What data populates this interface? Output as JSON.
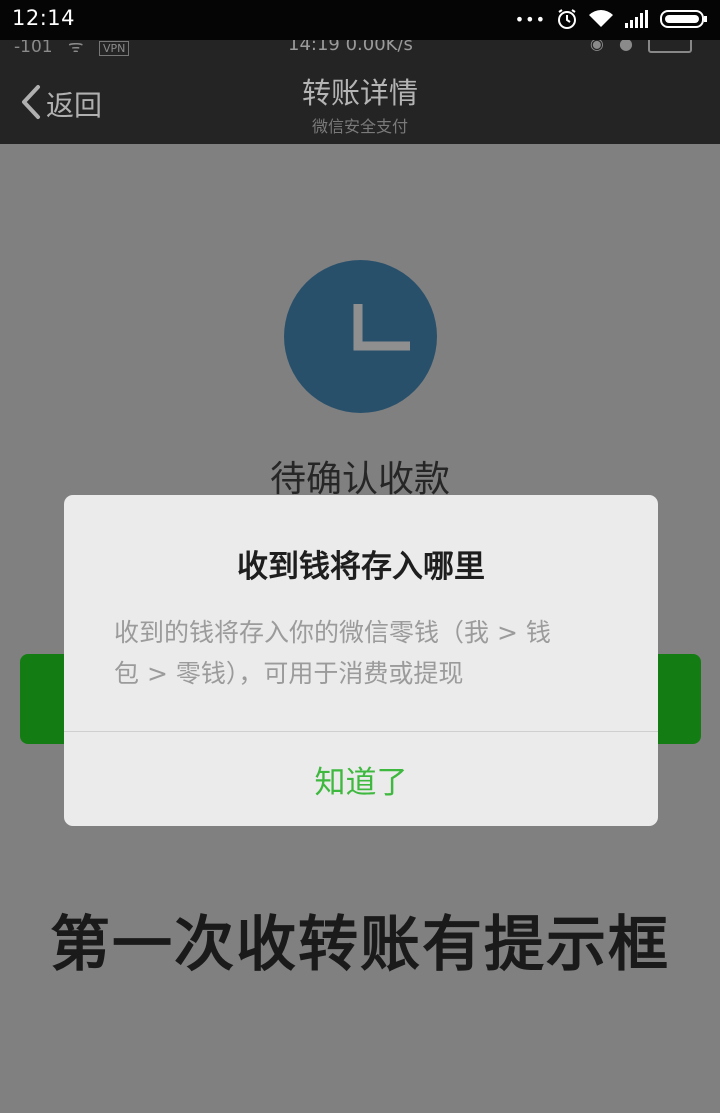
{
  "system_bar": {
    "time": "12:14",
    "more": "•••"
  },
  "video_status": {
    "left": "-101",
    "vpn": "VPN",
    "center": "14:19 0.00K/s"
  },
  "header": {
    "back_label": "返回",
    "title": "转账详情",
    "subtitle": "微信安全支付"
  },
  "transfer": {
    "status": "待确认收款"
  },
  "dialog": {
    "title": "收到钱将存入哪里",
    "body_line1": "收到的钱将存入你的微信零钱（我 > 钱",
    "body_line2": "包 > 零钱），可用于消费或提现",
    "action_label": "知道了"
  },
  "caption": "第一次收转账有提示框",
  "colors": {
    "overlay": "#808080",
    "clock": "#29506b",
    "confirm_button": "#137d13",
    "dialog_action": "#3fb83f"
  }
}
